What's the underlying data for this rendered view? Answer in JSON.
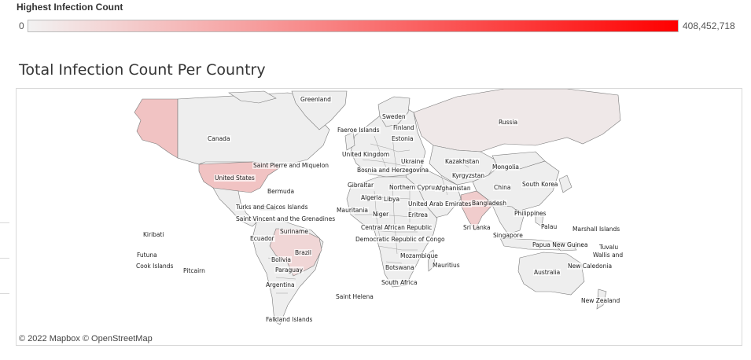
{
  "legend": {
    "title": "Highest Infection Count",
    "min_label": "0",
    "max_label": "408,452,718",
    "color_low": "#f2f2f2",
    "color_high": "#ff0000"
  },
  "chart_title": "Total Infection Count Per Country",
  "attribution": "© 2022 Mapbox  © OpenStreetMap",
  "colors": {
    "land_default": "#eeeeee",
    "land_border": "#7a7a7a",
    "usa": "#f1c3c3",
    "alaska": "#f1c3c3",
    "brazil": "#f0d6d6",
    "india": "#f0cccc",
    "russia": "#efe8e8"
  },
  "map_labels": [
    {
      "id": "greenland",
      "text": "Greenland"
    },
    {
      "id": "canada",
      "text": "Canada"
    },
    {
      "id": "russia",
      "text": "Russia"
    },
    {
      "id": "sweden",
      "text": "Sweden"
    },
    {
      "id": "faeroe",
      "text": "Faeroe Islands"
    },
    {
      "id": "finland",
      "text": "Finland"
    },
    {
      "id": "estonia",
      "text": "Estonia"
    },
    {
      "id": "uk",
      "text": "United Kingdom"
    },
    {
      "id": "ukraine",
      "text": "Ukraine"
    },
    {
      "id": "kazakhstan",
      "text": "Kazakhstan"
    },
    {
      "id": "mongolia",
      "text": "Mongolia"
    },
    {
      "id": "bosnia",
      "text": "Bosnia and Herzegovina"
    },
    {
      "id": "kyrgyzstan",
      "text": "Kyrgyzstan"
    },
    {
      "id": "spm",
      "text": "Saint Pierre and Miquelon"
    },
    {
      "id": "usa",
      "text": "United States"
    },
    {
      "id": "gibraltar",
      "text": "Gibraltar"
    },
    {
      "id": "ncyprus",
      "text": "Northern Cyprus"
    },
    {
      "id": "afghanistan",
      "text": "Afghanistan"
    },
    {
      "id": "china",
      "text": "China"
    },
    {
      "id": "skorea",
      "text": "South Korea"
    },
    {
      "id": "bermuda",
      "text": "Bermuda"
    },
    {
      "id": "algeria",
      "text": "Algeria"
    },
    {
      "id": "libya",
      "text": "Libya"
    },
    {
      "id": "uae",
      "text": "United Arab Emirates"
    },
    {
      "id": "bangladesh",
      "text": "Bangladesh"
    },
    {
      "id": "turks",
      "text": "Turks and Caicos Islands"
    },
    {
      "id": "mauritania",
      "text": "Mauritania"
    },
    {
      "id": "niger",
      "text": "Niger"
    },
    {
      "id": "eritrea",
      "text": "Eritrea"
    },
    {
      "id": "philippines",
      "text": "Philippines"
    },
    {
      "id": "svg",
      "text": "Saint Vincent and the Grenadines"
    },
    {
      "id": "car",
      "text": "Central African Republic"
    },
    {
      "id": "srilanka",
      "text": "Sri Lanka"
    },
    {
      "id": "palau",
      "text": "Palau"
    },
    {
      "id": "marshall",
      "text": "Marshall Islands"
    },
    {
      "id": "kiribati",
      "text": "Kiribati"
    },
    {
      "id": "suriname",
      "text": "Suriname"
    },
    {
      "id": "singapore",
      "text": "Singapore"
    },
    {
      "id": "ecuador",
      "text": "Ecuador"
    },
    {
      "id": "drc",
      "text": "Democratic Republic of Congo"
    },
    {
      "id": "png",
      "text": "Papua New Guinea"
    },
    {
      "id": "tuvalu",
      "text": "Tuvalu"
    },
    {
      "id": "brazil",
      "text": "Brazil"
    },
    {
      "id": "futuna",
      "text": "Futuna"
    },
    {
      "id": "mozambique",
      "text": "Mozambique"
    },
    {
      "id": "wallis",
      "text": "Wallis and"
    },
    {
      "id": "bolivia",
      "text": "Bolivia"
    },
    {
      "id": "cook",
      "text": "Cook Islands"
    },
    {
      "id": "mauritius",
      "text": "Mauritius"
    },
    {
      "id": "newcaledonia",
      "text": "New Caledonia"
    },
    {
      "id": "botswana",
      "text": "Botswana"
    },
    {
      "id": "pitcairn",
      "text": "Pitcairn"
    },
    {
      "id": "paraguay",
      "text": "Paraguay"
    },
    {
      "id": "australia",
      "text": "Australia"
    },
    {
      "id": "southafrica",
      "text": "South Africa"
    },
    {
      "id": "argentina",
      "text": "Argentina"
    },
    {
      "id": "sainthelena",
      "text": "Saint Helena"
    },
    {
      "id": "newzealand",
      "text": "New Zealand"
    },
    {
      "id": "falkland",
      "text": "Falkland Islands"
    }
  ]
}
